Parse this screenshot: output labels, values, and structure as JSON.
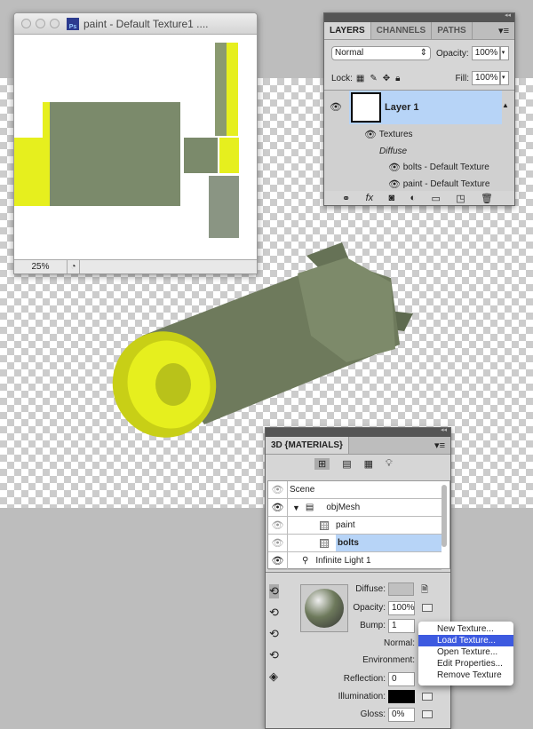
{
  "document": {
    "title": "paint - Default Texture1 ....",
    "app_icon": "Ps",
    "zoom": "25%"
  },
  "layers_panel": {
    "tabs": [
      "LAYERS",
      "CHANNELS",
      "PATHS"
    ],
    "blend_mode": "Normal",
    "opacity_label": "Opacity:",
    "opacity": "100%",
    "lock_label": "Lock:",
    "fill_label": "Fill:",
    "fill": "100%",
    "layer_name": "Layer 1",
    "textures_label": "Textures",
    "diffuse_label": "Diffuse",
    "textures": [
      "bolts - Default Texture",
      "paint - Default Texture"
    ]
  },
  "materials_panel": {
    "title": "3D {MATERIALS}",
    "scene_items": [
      {
        "label": "Scene"
      },
      {
        "label": "objMesh"
      },
      {
        "label": "paint"
      },
      {
        "label": "bolts",
        "selected": true
      },
      {
        "label": "Infinite Light 1"
      }
    ],
    "properties": {
      "diffuse_label": "Diffuse:",
      "opacity_label": "Opacity:",
      "opacity": "100%",
      "bump_label": "Bump:",
      "bump": "1",
      "normal_label": "Normal:",
      "environment_label": "Environment:",
      "reflection_label": "Reflection:",
      "reflection": "0",
      "illumination_label": "Illumination:",
      "gloss_label": "Gloss:",
      "gloss": "0%"
    }
  },
  "context_menu": {
    "items": [
      "New Texture...",
      "Load Texture...",
      "Open Texture...",
      "Edit Properties...",
      "Remove Texture"
    ],
    "selected": "Load Texture..."
  },
  "colors": {
    "selection": "#b7d4f7",
    "menu_highlight": "#3d5ae0",
    "texture_yellow": "#e6ef1e",
    "rocket_green": "#6e7a5c"
  }
}
